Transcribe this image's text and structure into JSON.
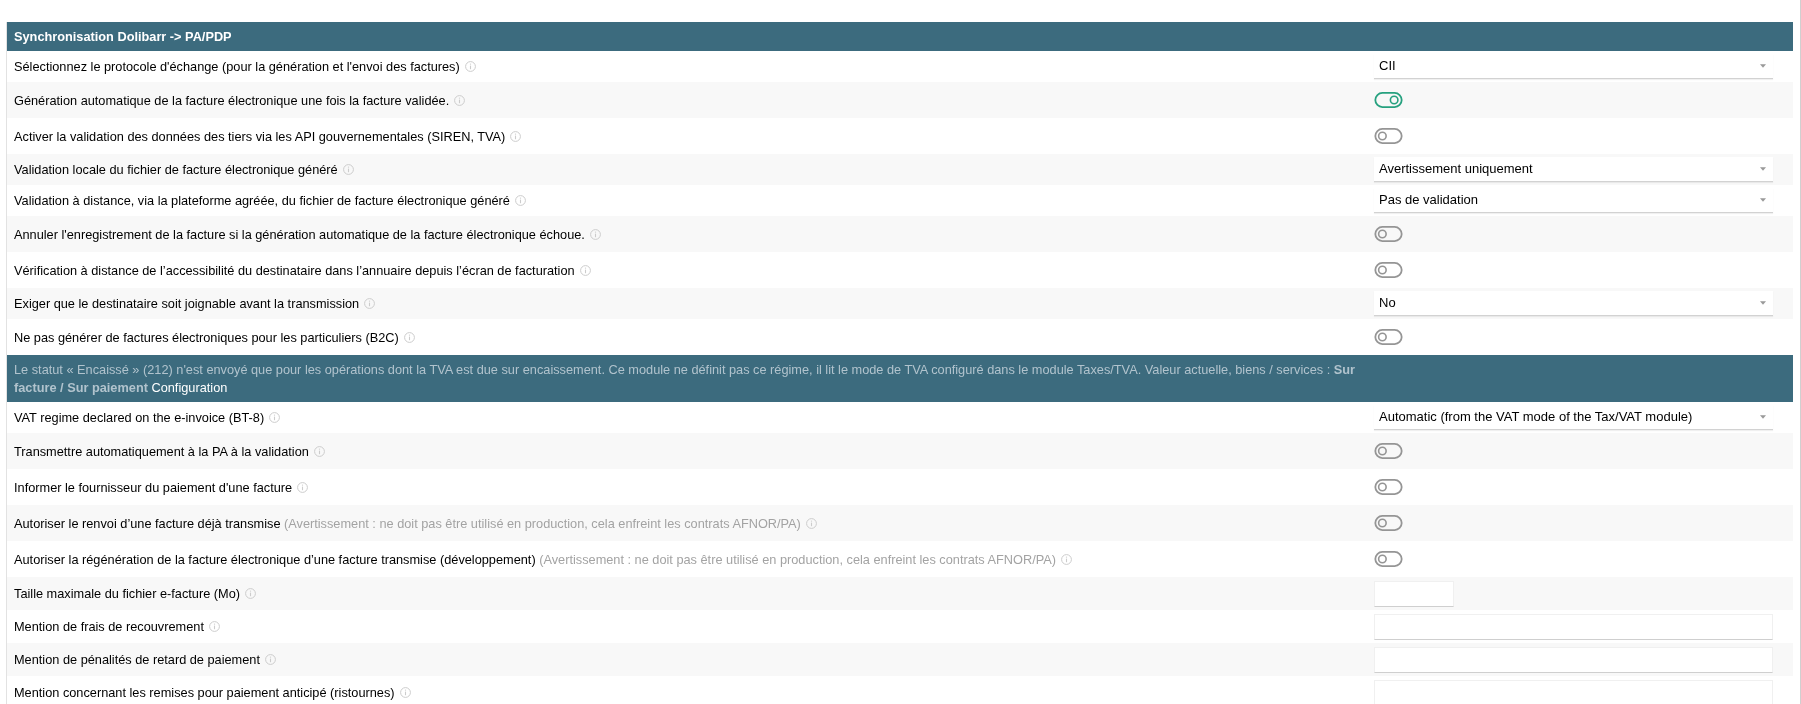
{
  "sections": [
    {
      "title": "Synchronisation Dolibarr -> PA/PDP",
      "rows": [
        {
          "label": "Sélectionnez le protocole d'échange (pour la génération et l'envoi des factures)",
          "kind": "select",
          "value": "CII"
        },
        {
          "label": "Génération automatique de la facture électronique une fois la facture validée.",
          "kind": "toggle",
          "on": true
        },
        {
          "label": "Activer la validation des données des tiers via les API gouvernementales (SIREN, TVA)",
          "kind": "toggle",
          "on": false
        },
        {
          "label": "Validation locale du fichier de facture électronique généré",
          "kind": "select",
          "value": "Avertissement uniquement"
        },
        {
          "label": "Validation à distance, via la plateforme agréée, du fichier de facture électronique généré",
          "kind": "select",
          "value": "Pas de validation"
        },
        {
          "label": "Annuler l'enregistrement de la facture si la génération automatique de la facture électronique échoue.",
          "kind": "toggle",
          "on": false
        },
        {
          "label": "Vérification à distance de l’accessibilité du destinataire dans l’annuaire depuis l’écran de facturation",
          "kind": "toggle",
          "on": false
        },
        {
          "label": "Exiger que le destinataire soit joignable avant la transmission",
          "kind": "select",
          "value": "No"
        },
        {
          "label": "Ne pas générer de factures électroniques pour les particuliers (B2C)",
          "kind": "toggle",
          "on": false
        }
      ]
    },
    {
      "note": "Le statut « Encaissé » (212) n'est envoyé que pour les opérations dont la TVA est due sur encaissement. Ce module ne définit pas ce régime, il lit le mode de TVA configuré dans le module Taxes/TVA. Valeur actuelle, biens / services : **Sur facture / Sur paiement**",
      "title": "Configuration",
      "rows": [
        {
          "label": "VAT regime declared on the e-invoice (BT-8)",
          "kind": "select",
          "value": "Automatic (from the VAT mode of the Tax/VAT module)"
        },
        {
          "label": "Transmettre automatiquement à la PA à la validation",
          "kind": "toggle",
          "on": false
        },
        {
          "label": "Informer le fournisseur du paiement d'une facture",
          "kind": "toggle",
          "on": false
        },
        {
          "label": "Autoriser le renvoi d’une facture déjà transmise",
          "note": "(Avertissement : ne doit pas être utilisé en production, cela enfreint les contrats AFNOR/PA)",
          "kind": "toggle",
          "on": false
        },
        {
          "label": "Autoriser la régénération de la facture électronique d’une facture transmise (développement)",
          "note": "(Avertissement : ne doit pas être utilisé en production, cela enfreint les contrats AFNOR/PA)",
          "kind": "toggle",
          "on": false
        },
        {
          "label": "Taille maximale du fichier e-facture (Mo)",
          "kind": "number_input"
        },
        {
          "label": "Mention de frais de recouvrement",
          "kind": "text_input"
        },
        {
          "label": "Mention de pénalités de retard de paiement",
          "kind": "text_input"
        },
        {
          "label": "Mention concernant les remises pour paiement anticipé (ristournes)",
          "kind": "text_input"
        }
      ]
    }
  ]
}
